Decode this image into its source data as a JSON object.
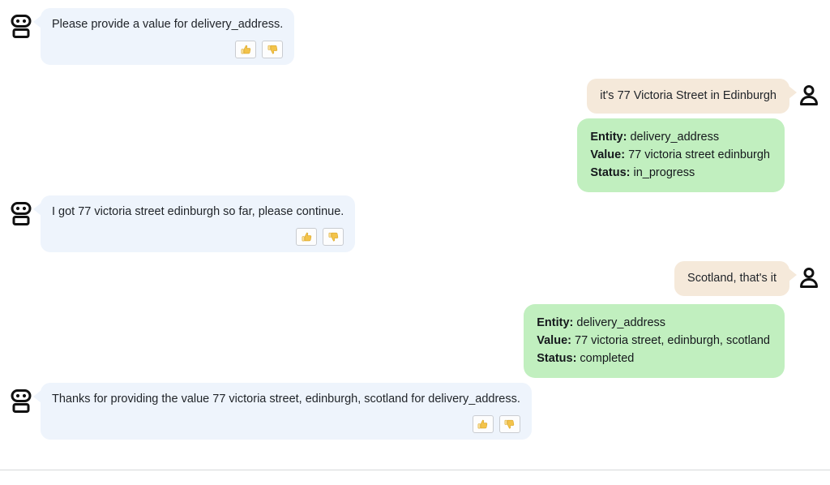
{
  "colors": {
    "bot_bubble": "#eef4fc",
    "user_bubble": "#f5e9da",
    "entity_card": "#c1efbf",
    "page_background": "#ffffff",
    "divider": "#d6d8da",
    "text": "#1f2328"
  },
  "icons": {
    "bot": "robot-icon",
    "user": "person-icon",
    "thumbs_up": "thumbs-up-icon",
    "thumbs_down": "thumbs-down-icon"
  },
  "feedback": {
    "thumbs_up_label": "👍",
    "thumbs_down_label": "👎"
  },
  "entity_card_labels": {
    "entity": "Entity:",
    "value": "Value:",
    "status": "Status:"
  },
  "messages": {
    "bot_1": {
      "sender": "bot",
      "text": "Please provide a value for delivery_address."
    },
    "user_1": {
      "sender": "user",
      "text": "it's 77 Victoria Street in Edinburgh"
    },
    "card_1": {
      "entity": "delivery_address",
      "value": "77 victoria street edinburgh",
      "status": "in_progress"
    },
    "bot_2": {
      "sender": "bot",
      "text": "I got 77 victoria street edinburgh so far, please continue."
    },
    "user_2": {
      "sender": "user",
      "text": "Scotland, that's it"
    },
    "card_2": {
      "entity": "delivery_address",
      "value": "77 victoria street, edinburgh, scotland",
      "status": "completed"
    },
    "bot_3": {
      "sender": "bot",
      "text": "Thanks for providing the value 77 victoria street, edinburgh, scotland for delivery_address."
    }
  }
}
